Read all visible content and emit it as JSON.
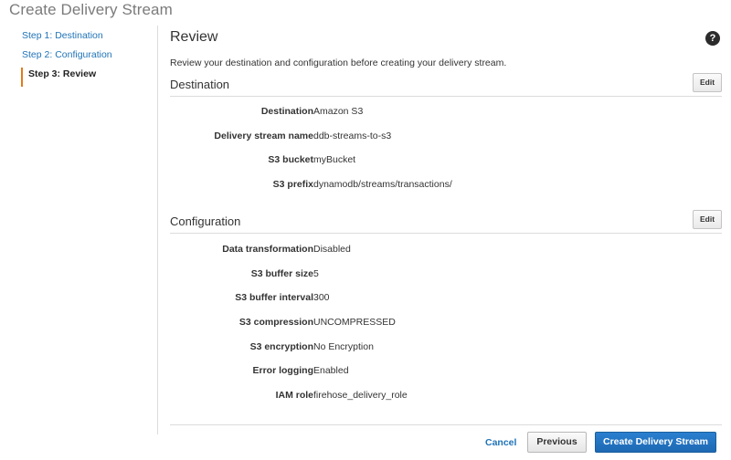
{
  "page": {
    "title": "Create Delivery Stream"
  },
  "steps": [
    {
      "label": "Step 1: Destination"
    },
    {
      "label": "Step 2: Configuration"
    },
    {
      "label": "Step 3: Review"
    }
  ],
  "review": {
    "title": "Review",
    "help_icon": "?",
    "description": "Review your destination and configuration before creating your delivery stream."
  },
  "destination": {
    "title": "Destination",
    "edit_label": "Edit",
    "rows": [
      {
        "key": "Destination",
        "value": "Amazon S3"
      },
      {
        "key": "Delivery stream name",
        "value": "ddb-streams-to-s3"
      },
      {
        "key": "S3 bucket",
        "value": "myBucket"
      },
      {
        "key": "S3 prefix",
        "value": "dynamodb/streams/transactions/"
      }
    ]
  },
  "configuration": {
    "title": "Configuration",
    "edit_label": "Edit",
    "rows": [
      {
        "key": "Data transformation",
        "value": "Disabled"
      },
      {
        "key": "S3 buffer size",
        "value": "5"
      },
      {
        "key": "S3 buffer interval",
        "value": "300"
      },
      {
        "key": "S3 compression",
        "value": "UNCOMPRESSED"
      },
      {
        "key": "S3 encryption",
        "value": "No Encryption"
      },
      {
        "key": "Error logging",
        "value": "Enabled"
      },
      {
        "key": "IAM role",
        "value": "firehose_delivery_role"
      }
    ]
  },
  "footer": {
    "cancel_label": "Cancel",
    "previous_label": "Previous",
    "create_label": "Create Delivery Stream"
  },
  "colors": {
    "link": "#1f73b7",
    "active_step_marker": "#e07b1a",
    "primary_button": "#1d68b3"
  }
}
